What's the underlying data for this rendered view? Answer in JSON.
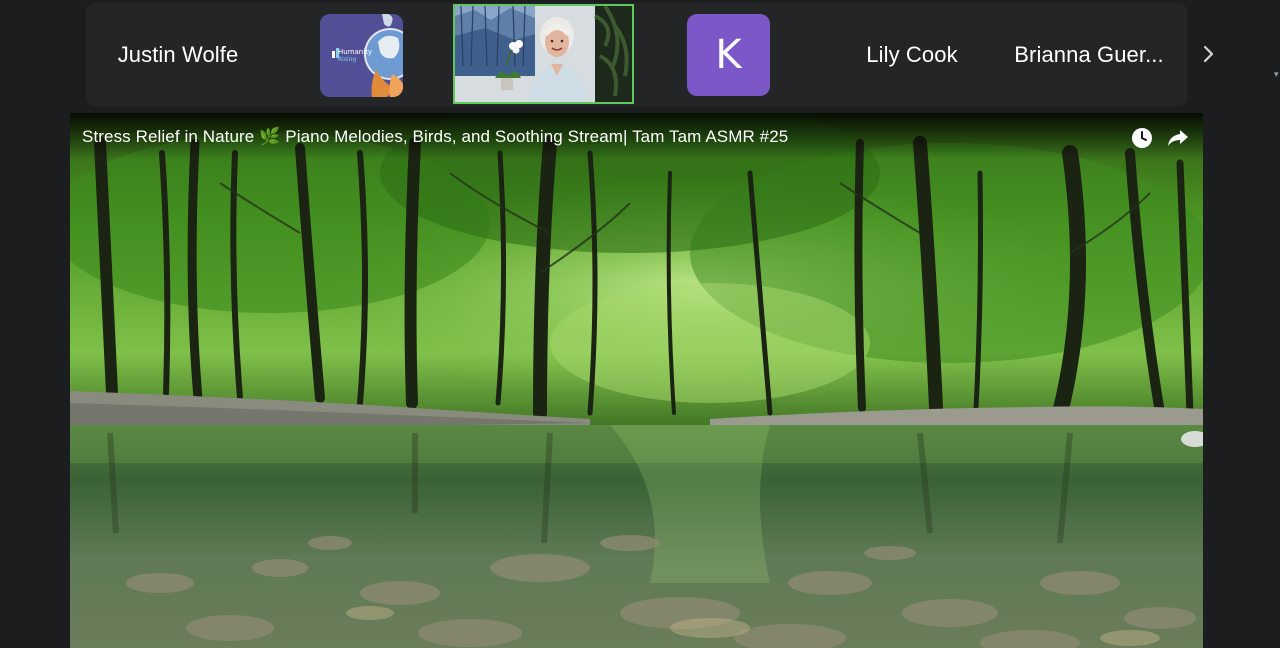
{
  "participants": {
    "tiles": [
      {
        "name": "Justin Wolfe"
      },
      {
        "name": "Lily Cook"
      },
      {
        "name": "Brianna Guer..."
      }
    ],
    "logo_tile": {
      "line1": "Humanity",
      "line2": "Rising",
      "bg": "#534f97"
    },
    "avatar": {
      "initial": "K",
      "bg": "#7c57c8"
    },
    "active_speaker_border": "#5ec95a",
    "next_icon": "chevron-right-icon"
  },
  "shared_video": {
    "title": "Stress Relief in Nature 🌿 Piano Melodies, Birds, and Soothing Stream| Tam Tam ASMR #25",
    "icons": [
      "clock-icon",
      "share-icon"
    ]
  },
  "colors": {
    "background": "#1c1d1f",
    "strip": "#242527",
    "forest": "#5aa32a",
    "water": "#3d5d3a"
  }
}
